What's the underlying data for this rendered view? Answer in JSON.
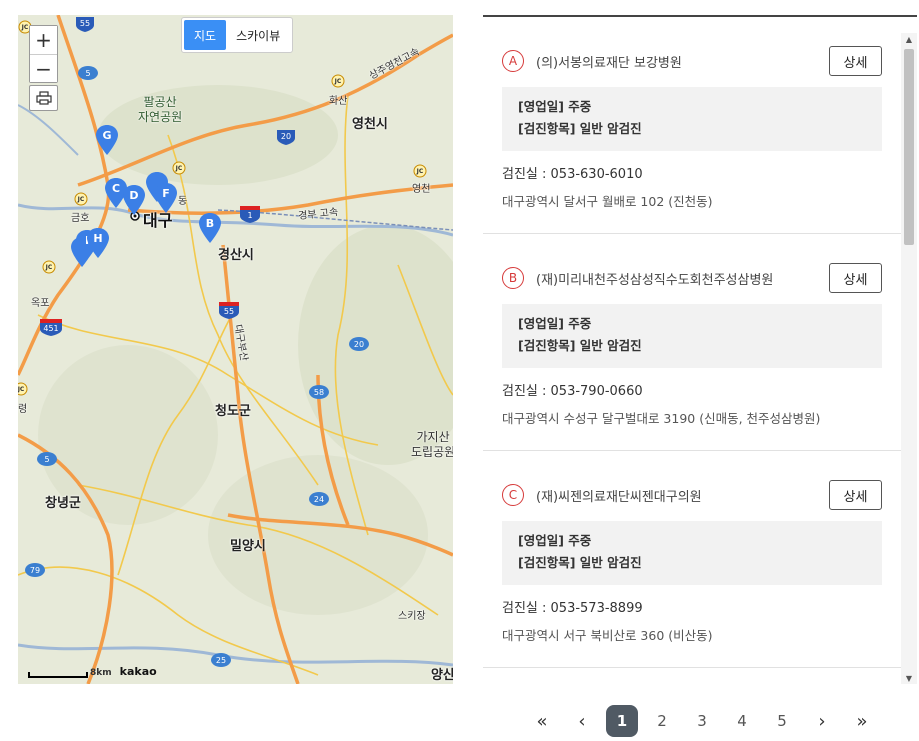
{
  "map": {
    "zoom_in": "+",
    "zoom_out": "−",
    "map_type": {
      "map": "지도",
      "skyview": "스카이뷰"
    },
    "scale": "8km",
    "brand": "kakao",
    "labels": {
      "palgong": "팔공산\n자연공원",
      "daegu": "대구",
      "gyeongsan": "경산시",
      "yeongcheon": "영천시",
      "cheongdo": "청도군",
      "changnyeong": "창녕군",
      "miryang": "밀양시",
      "gajisan": "가지산\n도립공원",
      "hwasan": "화산",
      "yeongcheon_jc": "영천",
      "geumho": "금호",
      "okpo": "옥포",
      "dong": "동",
      "ryeong": "령",
      "sukijang": "스키장",
      "yang": "양산",
      "gyeongbu": "경부 고속",
      "sangju": "상주영천고속",
      "daegu_busan": "대구부산"
    },
    "shields": [
      "55",
      "5",
      "20",
      "1",
      "55",
      "451",
      "20",
      "58",
      "5",
      "24",
      "79",
      "25"
    ],
    "pins": [
      "G",
      "C",
      "D",
      "F",
      "I",
      "H",
      "B"
    ],
    "colors": {
      "pin": "#3b7fe6",
      "highway": "#f39c48",
      "road": "#f2c94c",
      "river": "#9fb8d6"
    }
  },
  "list": {
    "items": [
      {
        "badge": "A",
        "name": "(의)서봉의료재단 보강병원",
        "detail": "상세",
        "hours": "[영업일] 주중",
        "exam": "[검진항목] 일반 암검진",
        "phone": "검진실 :  053-630-6010",
        "address": "대구광역시 달서구 월배로 102 (진천동)"
      },
      {
        "badge": "B",
        "name": "(재)미리내천주성삼성직수도회천주성삼병원",
        "detail": "상세",
        "hours": "[영업일] 주중",
        "exam": "[검진항목] 일반 암검진",
        "phone": "검진실 :  053-790-0660",
        "address": "대구광역시 수성구 달구벌대로 3190 (신매동, 천주성삼병원)"
      },
      {
        "badge": "C",
        "name": "(재)씨젠의료재단씨젠대구의원",
        "detail": "상세",
        "hours": "[영업일] 주중",
        "exam": "[검진항목] 일반 암검진",
        "phone": "검진실 :  053-573-8899",
        "address": "대구광역시 서구 북비산로 360 (비산동)"
      }
    ]
  },
  "pagination": {
    "first": "«",
    "prev": "‹",
    "pages": [
      "1",
      "2",
      "3",
      "4",
      "5"
    ],
    "current": "1",
    "next": "›",
    "last": "»"
  },
  "colors": {
    "accent": "#d63a3a",
    "current_page": "#505a64",
    "maptype_active": "#3a8ff5"
  }
}
